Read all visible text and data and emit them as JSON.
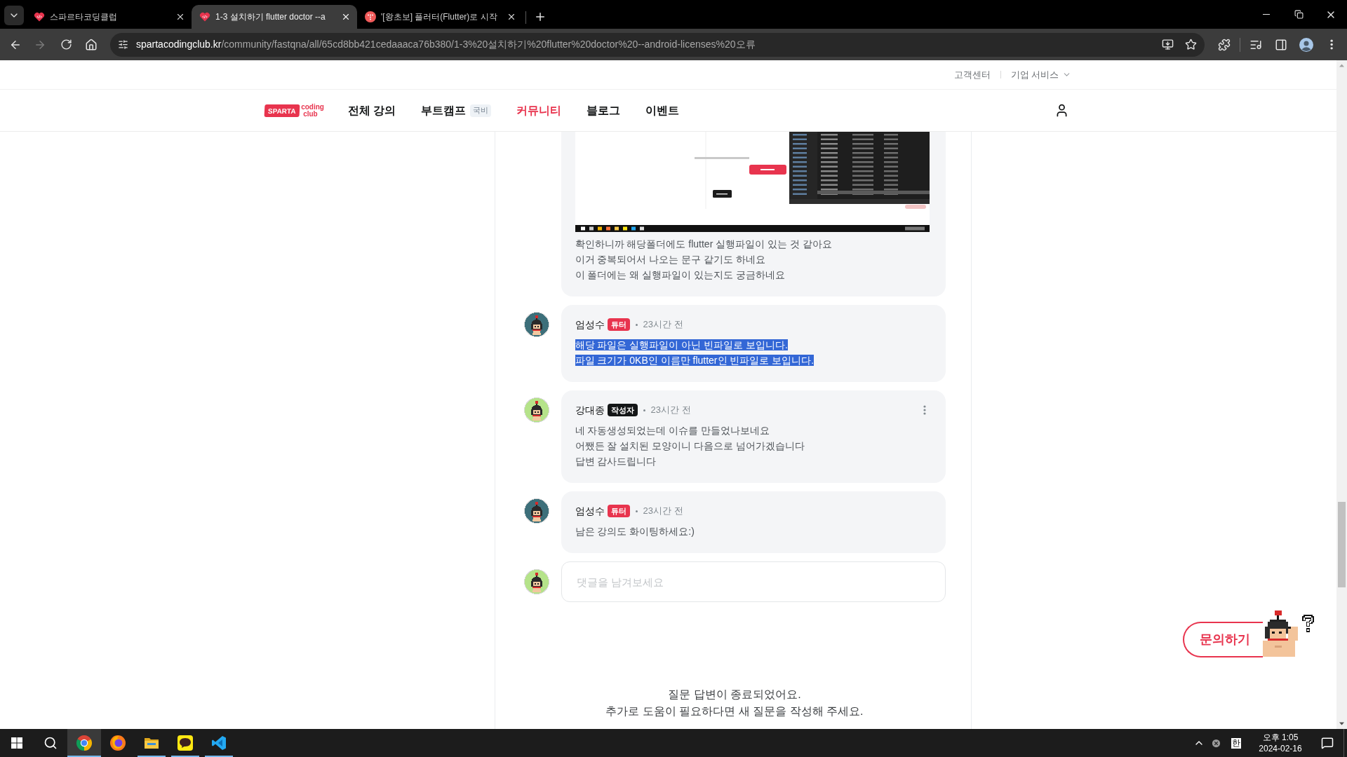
{
  "browser": {
    "tabs": [
      {
        "title": "스파르타코딩클럽",
        "selected": false,
        "kind": "heart"
      },
      {
        "title": "1-3 설치하기 flutter doctor --a",
        "selected": true,
        "kind": "heart"
      },
      {
        "title": "'[왕초보] 플러터(Flutter)로 시작",
        "selected": false,
        "kind": "disc"
      }
    ],
    "forward_disabled": true,
    "address": {
      "host": "spartacodingclub.kr",
      "path": "/community/fastqna/all/65cd8bb421cedaaaca76b380/1-3%20설치하기%20flutter%20doctor%20--android-licenses%20오류"
    }
  },
  "site": {
    "utility_links": [
      {
        "label": "고객센터",
        "dropdown": false
      },
      {
        "label": "기업 서비스",
        "dropdown": true
      }
    ],
    "logo": {
      "mark": "SPARTA",
      "word_lines": [
        "coding",
        "club"
      ]
    },
    "nav": [
      {
        "label": "전체 강의",
        "selected": false
      },
      {
        "label": "부트캠프",
        "badge": "국비",
        "selected": false
      },
      {
        "label": "커뮤니티",
        "selected": true
      },
      {
        "label": "블로그",
        "selected": false
      },
      {
        "label": "이벤트",
        "selected": false
      }
    ]
  },
  "thread": {
    "comments": [
      {
        "kind": "continuation",
        "lines": [
          "확인하니까 해당폴더에도 flutter 실행파일이 있는 것 같아요",
          "이거 중복되어서 나오는 문구 같기도 하네요",
          "이 폴더에는 왜 실행파일이 있는지도 궁금하네요"
        ],
        "highlighted": false
      },
      {
        "kind": "reply",
        "author": "엄성수",
        "badge": {
          "label": "튜터",
          "color": "#e8344e"
        },
        "time": "23시간 전",
        "avatar": {
          "color": "#3d6f7a"
        },
        "lines": [
          "해당 파일은 실행파일이 아닌 빈파일로 보입니다.",
          "파일 크기가 0KB인 이름만 flutter인 빈파일로 보입니다."
        ],
        "highlighted": true,
        "more_menu": false
      },
      {
        "kind": "reply",
        "author": "강대종",
        "badge": {
          "label": "작성자",
          "color": "#141617"
        },
        "time": "23시간 전",
        "avatar": {
          "color": "#b5e38a"
        },
        "lines": [
          "네 자동생성되었는데 이슈를 만들었나보네요",
          "어쨌든 잘 설치된 모양이니 다음으로 넘어가겠습니다",
          "답변 감사드립니다"
        ],
        "highlighted": false,
        "more_menu": true
      },
      {
        "kind": "reply",
        "author": "엄성수",
        "badge": {
          "label": "튜터",
          "color": "#e8344e"
        },
        "time": "23시간 전",
        "avatar": {
          "color": "#3d6f7a"
        },
        "lines": [
          "남은 강의도 화이팅하세요:)"
        ],
        "highlighted": false,
        "more_menu": false
      }
    ],
    "comment_box": {
      "placeholder": "댓글을 남겨보세요",
      "avatar": {
        "color": "#b5e38a"
      }
    },
    "closed_notice": [
      "질문 답변이 종료되었어요.",
      "추가로 도움이 필요하다면 새 질문을 작성해 주세요."
    ]
  },
  "inquiry_button": {
    "label": "문의하기"
  },
  "taskbar": {
    "apps": [
      {
        "kind": "ring",
        "selected": true,
        "running": true
      },
      {
        "kind": "flame",
        "selected": false,
        "running": false
      },
      {
        "kind": "folder",
        "selected": false,
        "running": true
      },
      {
        "kind": "talk",
        "selected": false,
        "running": true
      },
      {
        "kind": "code",
        "selected": false,
        "running": true
      }
    ],
    "tray": {
      "ime": "한",
      "time": "오후 1:05",
      "date": "2024-02-16"
    }
  }
}
